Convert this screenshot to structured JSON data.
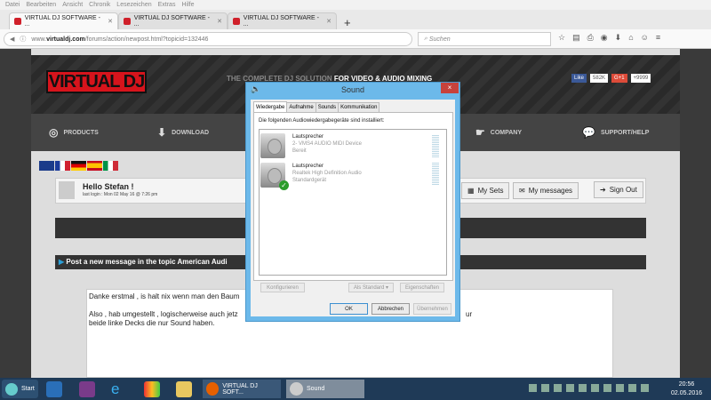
{
  "browser": {
    "menu": [
      "Datei",
      "Bearbeiten",
      "Ansicht",
      "Chronik",
      "Lesezeichen",
      "Extras",
      "Hilfe"
    ],
    "tabs": [
      {
        "label": "VIRTUAL DJ SOFTWARE - ..."
      },
      {
        "label": "VIRTUAL DJ SOFTWARE - ..."
      },
      {
        "label": "VIRTUAL DJ SOFTWARE - ..."
      }
    ],
    "new_tab": "+",
    "url_prefix": "www.",
    "url_domain": "virtualdj.com",
    "url_path": "/forums/action/newpost.html?topicid=132446",
    "search_placeholder": "Suchen"
  },
  "site": {
    "logo": "VIRTUAL DJ",
    "tagline_a": "THE COMPLETE DJ SOLUTION ",
    "tagline_b": "FOR VIDEO & AUDIO MIXING",
    "fb_like": "Like",
    "fb_count": "582K",
    "gplus": "G+1",
    "gplus_count": "+9999",
    "nav": [
      "PRODUCTS",
      "DOWNLOAD",
      "COMPANY",
      "SUPPORT/HELP"
    ],
    "hello": "Hello Stefan !",
    "last_login": "last login : Mon 02 May 16 @ 7:26 pm",
    "my_sets": "My Sets",
    "my_messages": "My messages",
    "sign_out": "Sign Out",
    "post_title": "Post a new message in the topic American Audi",
    "message_lines": [
      "Danke erstmal , is halt nix wenn man den Baum",
      "Also , hab umgestellt , logischerweise auch jetz",
      "beide linke Decks die nur Sound haben."
    ],
    "message_tail": "ur"
  },
  "dialog": {
    "title": "Sound",
    "close": "×",
    "tabs": [
      "Wiedergabe",
      "Aufnahme",
      "Sounds",
      "Kommunikation"
    ],
    "label": "Die folgenden Audiowiedergabegeräte sind installiert:",
    "devices": [
      {
        "name": "Lautsprecher",
        "desc": "2- VMS4 AUDIO MIDI Device",
        "status": "Bereit",
        "default": false
      },
      {
        "name": "Lautsprecher",
        "desc": "Realtek High Definition Audio",
        "status": "Standardgerät",
        "default": true
      }
    ],
    "configure": "Konfigurieren",
    "set_default": "Als Standard",
    "properties": "Eigenschaften",
    "ok": "OK",
    "cancel": "Abbrechen",
    "apply": "Übernehmen"
  },
  "taskbar": {
    "start": "Start",
    "firefox": "VIRTUAL DJ SOFT...",
    "sound": "Sound",
    "time": "20:56",
    "date": "02.05.2016"
  }
}
